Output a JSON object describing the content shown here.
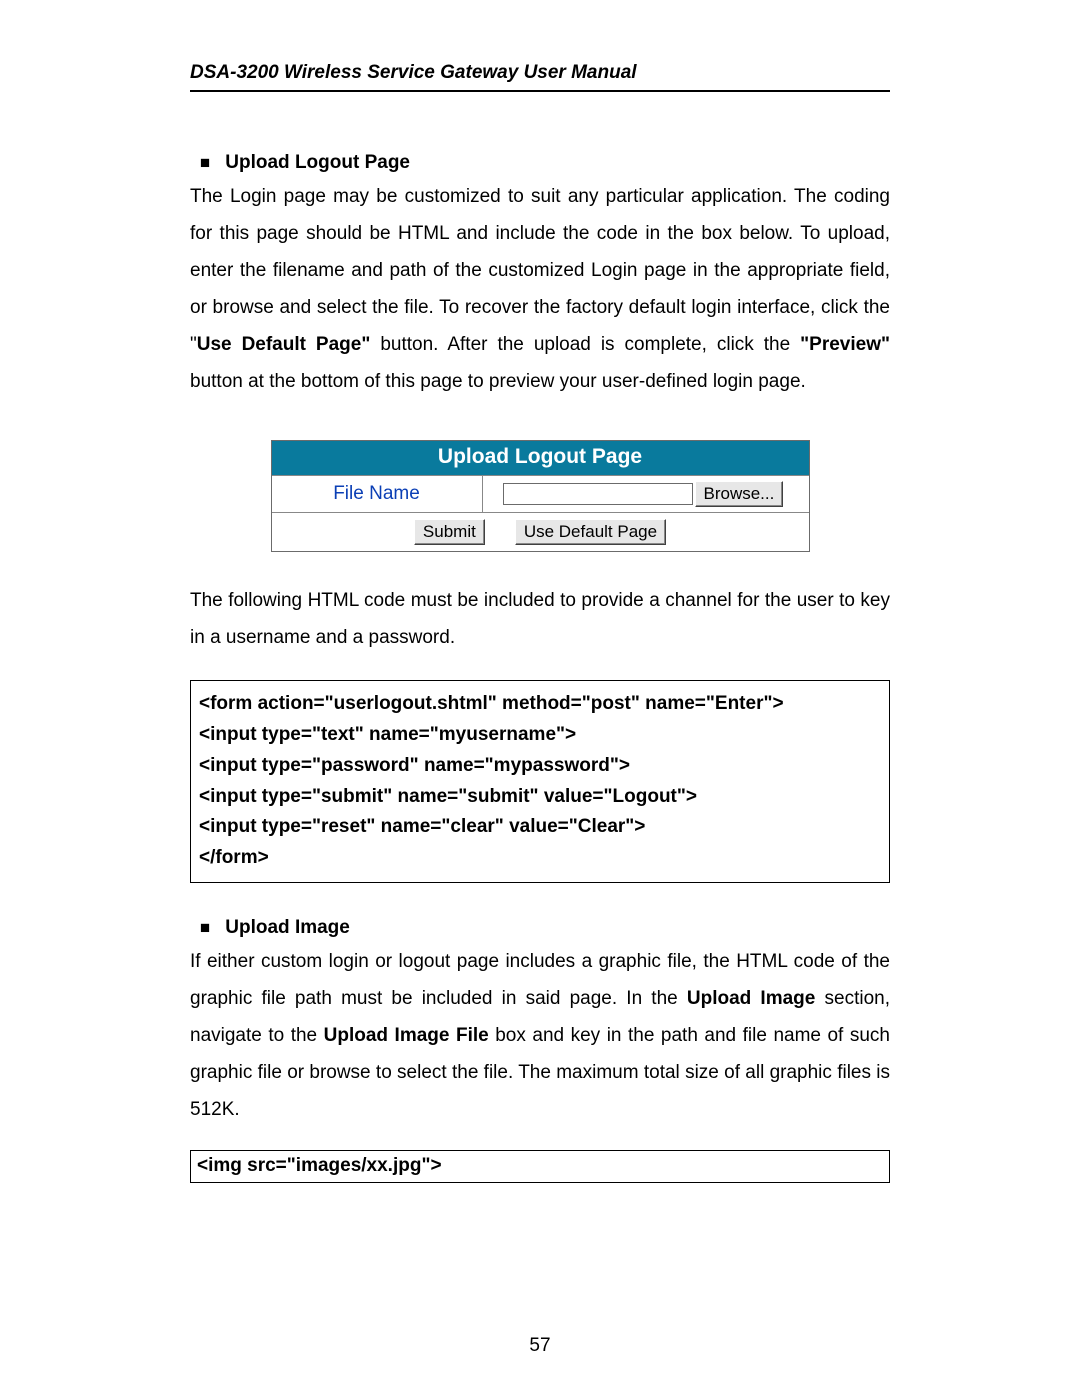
{
  "header": {
    "title": "DSA-3200 Wireless Service Gateway User Manual"
  },
  "section1": {
    "bullet": "■",
    "heading": "Upload Logout Page",
    "p1_a": "The Login page may be customized to suit any particular application. The coding for this page should be HTML and include the code in the box below. To upload, enter the filename and path of the customized Login page in the appropriate field, or browse and select the file. To recover the factory default login interface, click the \"",
    "p1_b": "Use Default Page\"",
    "p1_c": " button. After the upload is complete, click the ",
    "p1_d": "\"Preview\"",
    "p1_e": " button at the bottom of this page to preview your user-defined login page."
  },
  "panel": {
    "title": "Upload Logout Page",
    "file_name_label": "File Name",
    "file_input_value": "",
    "browse_label": "Browse...",
    "submit_label": "Submit",
    "default_label": "Use Default Page"
  },
  "after_panel": {
    "text": "The following HTML code must be included to provide a channel for the user to key in a username and a password."
  },
  "codebox1": {
    "l1": "<form action=\"userlogout.shtml\" method=\"post\" name=\"Enter\">",
    "l2": "<input type=\"text\" name=\"myusername\">",
    "l3": "<input type=\"password\" name=\"mypassword\">",
    "l4": "<input type=\"submit\" name=\"submit\" value=\"Logout\">",
    "l5": "<input type=\"reset\" name=\"clear\" value=\"Clear\">",
    "l6": "</form>"
  },
  "section2": {
    "bullet": "■",
    "heading": "Upload Image",
    "p_a": "If either custom login or logout page includes a graphic file, the HTML code of the graphic file path must be included in said page. In the ",
    "p_b": "Upload Image",
    "p_c": " section, navigate to the ",
    "p_d": "Upload Image File",
    "p_e": " box and key in the path and file name of such graphic file or browse to select the file. The maximum total size of all graphic files is 512K."
  },
  "codebox2": {
    "l1": "<img src=\"images/xx.jpg\">"
  },
  "page_number": "57"
}
